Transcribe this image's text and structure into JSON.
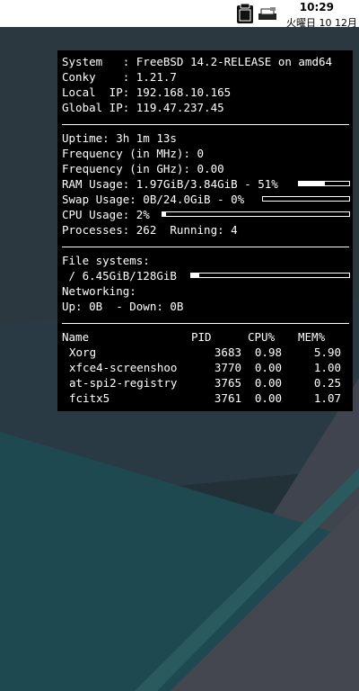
{
  "panel": {
    "time": "10:29",
    "date": "火曜日 10 12月",
    "icons": [
      "clipboard-icon",
      "printer-tray-icon"
    ]
  },
  "colors": {
    "panel_bg": "#ffffff",
    "conky_bg": "#000000",
    "conky_fg": "#ffffff",
    "wallpaper_dark": "#243038",
    "wallpaper_teal": "#1f4a50",
    "wallpaper_gray": "#454a55"
  },
  "conky": {
    "system": "System   : FreeBSD 14.2-RELEASE on amd64",
    "conky": "Conky    : 1.21.7",
    "local_ip": "Local  IP: 192.168.10.165",
    "global_ip": "Global IP: 119.47.237.45",
    "uptime": "Uptime: 3h 1m 13s",
    "freq_mhz": "Frequency (in MHz): 0",
    "freq_ghz": "Frequency (in GHz): 0.00",
    "ram": "RAM Usage: 1.97GiB/3.84GiB - 51%",
    "ram_percent": 51,
    "swap": "Swap Usage: 0B/24.0GiB - 0%",
    "swap_percent": 0,
    "cpu": "CPU Usage: 2%",
    "cpu_percent": 2,
    "processes": "Processes: 262  Running: 4",
    "filesystems": "File systems:",
    "fs_root": " / 6.45GiB/128GiB",
    "fs_percent": 5,
    "networking": "Networking:",
    "network": "Up: 0B  - Down: 0B",
    "proc_headers": {
      "name": "Name",
      "pid": "PID",
      "cpu": "CPU%",
      "mem": "MEM%"
    },
    "proc_rows": [
      {
        "name": "Xorg",
        "pid": "3683",
        "cpu": "0.98",
        "mem": "5.90"
      },
      {
        "name": "xfce4-screenshoo",
        "pid": "3770",
        "cpu": "0.00",
        "mem": "1.00"
      },
      {
        "name": "at-spi2-registry",
        "pid": "3765",
        "cpu": "0.00",
        "mem": "0.25"
      },
      {
        "name": "fcitx5",
        "pid": "3761",
        "cpu": "0.00",
        "mem": "1.07"
      }
    ]
  }
}
